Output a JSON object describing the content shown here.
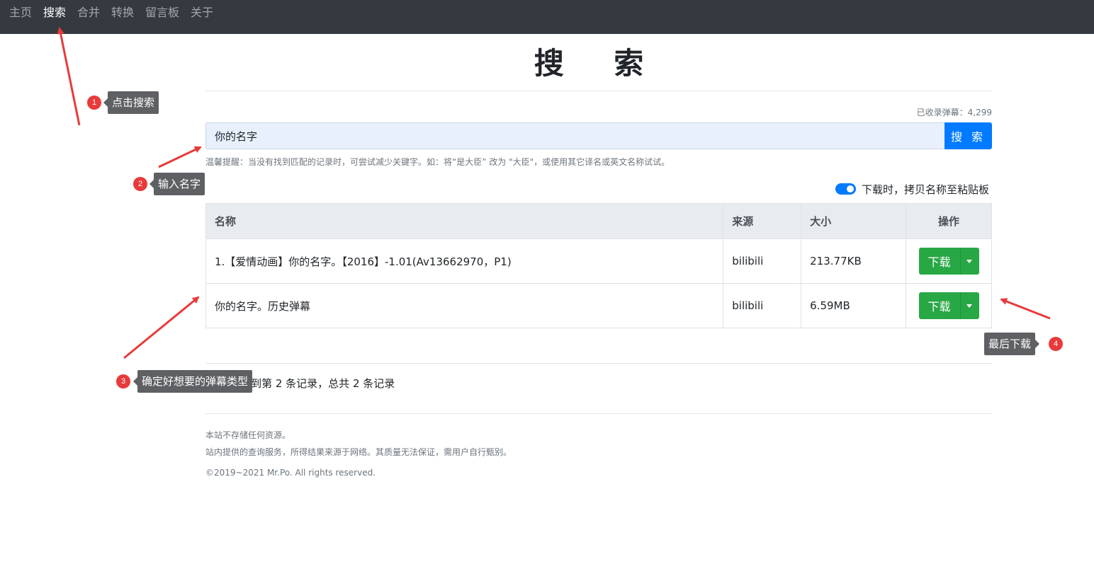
{
  "nav": {
    "items": [
      "主页",
      "搜索",
      "合并",
      "转换",
      "留言板",
      "关于"
    ],
    "active_index": 1
  },
  "title": "搜 索",
  "count": {
    "label": "已收录弹幕：",
    "value": "4,299"
  },
  "search": {
    "value": "你的名字",
    "button_label": "搜 索"
  },
  "hint": "温馨提醒：当没有找到匹配的记录时，可尝试减少关键字。如：将“是大臣” 改为 \"大臣\"，或使用其它译名或英文名称试试。",
  "toggle": {
    "label": "下载时，拷贝名称至粘贴板",
    "on": true
  },
  "table": {
    "headers": {
      "name": "名称",
      "source": "来源",
      "size": "大小",
      "action": "操作"
    },
    "rows": [
      {
        "name": "1.【爱情动画】你的名字。【2016】-1.01(Av13662970，P1)",
        "source": "bilibili",
        "size": "213.77KB",
        "button": "下载"
      },
      {
        "name": "你的名字。历史弹幕",
        "source": "bilibili",
        "size": "6.59MB",
        "button": "下载"
      }
    ]
  },
  "pager": {
    "hidden_prefix": "显示第 1 到",
    "visible": "第 2 条记录，总共 2 条记录"
  },
  "footer": {
    "line1": "本站不存储任何资源。",
    "line2": "站内提供的查询服务，所得结果来源于网络。其质量无法保证，需用户自行甄别。",
    "copyright": "©2019~2021 Mr.Po. All rights reserved."
  },
  "annotations": [
    {
      "number": "1",
      "text": "点击搜索"
    },
    {
      "number": "2",
      "text": "输入名字"
    },
    {
      "number": "3",
      "text": "确定好想要的弹幕类型"
    },
    {
      "number": "4",
      "text": "最后下载"
    }
  ],
  "colors": {
    "navbar": "#343a40",
    "primary": "#007bff",
    "success": "#28a745",
    "annotation_red": "#e83a3a",
    "tooltip_gray": "#5f6064"
  }
}
